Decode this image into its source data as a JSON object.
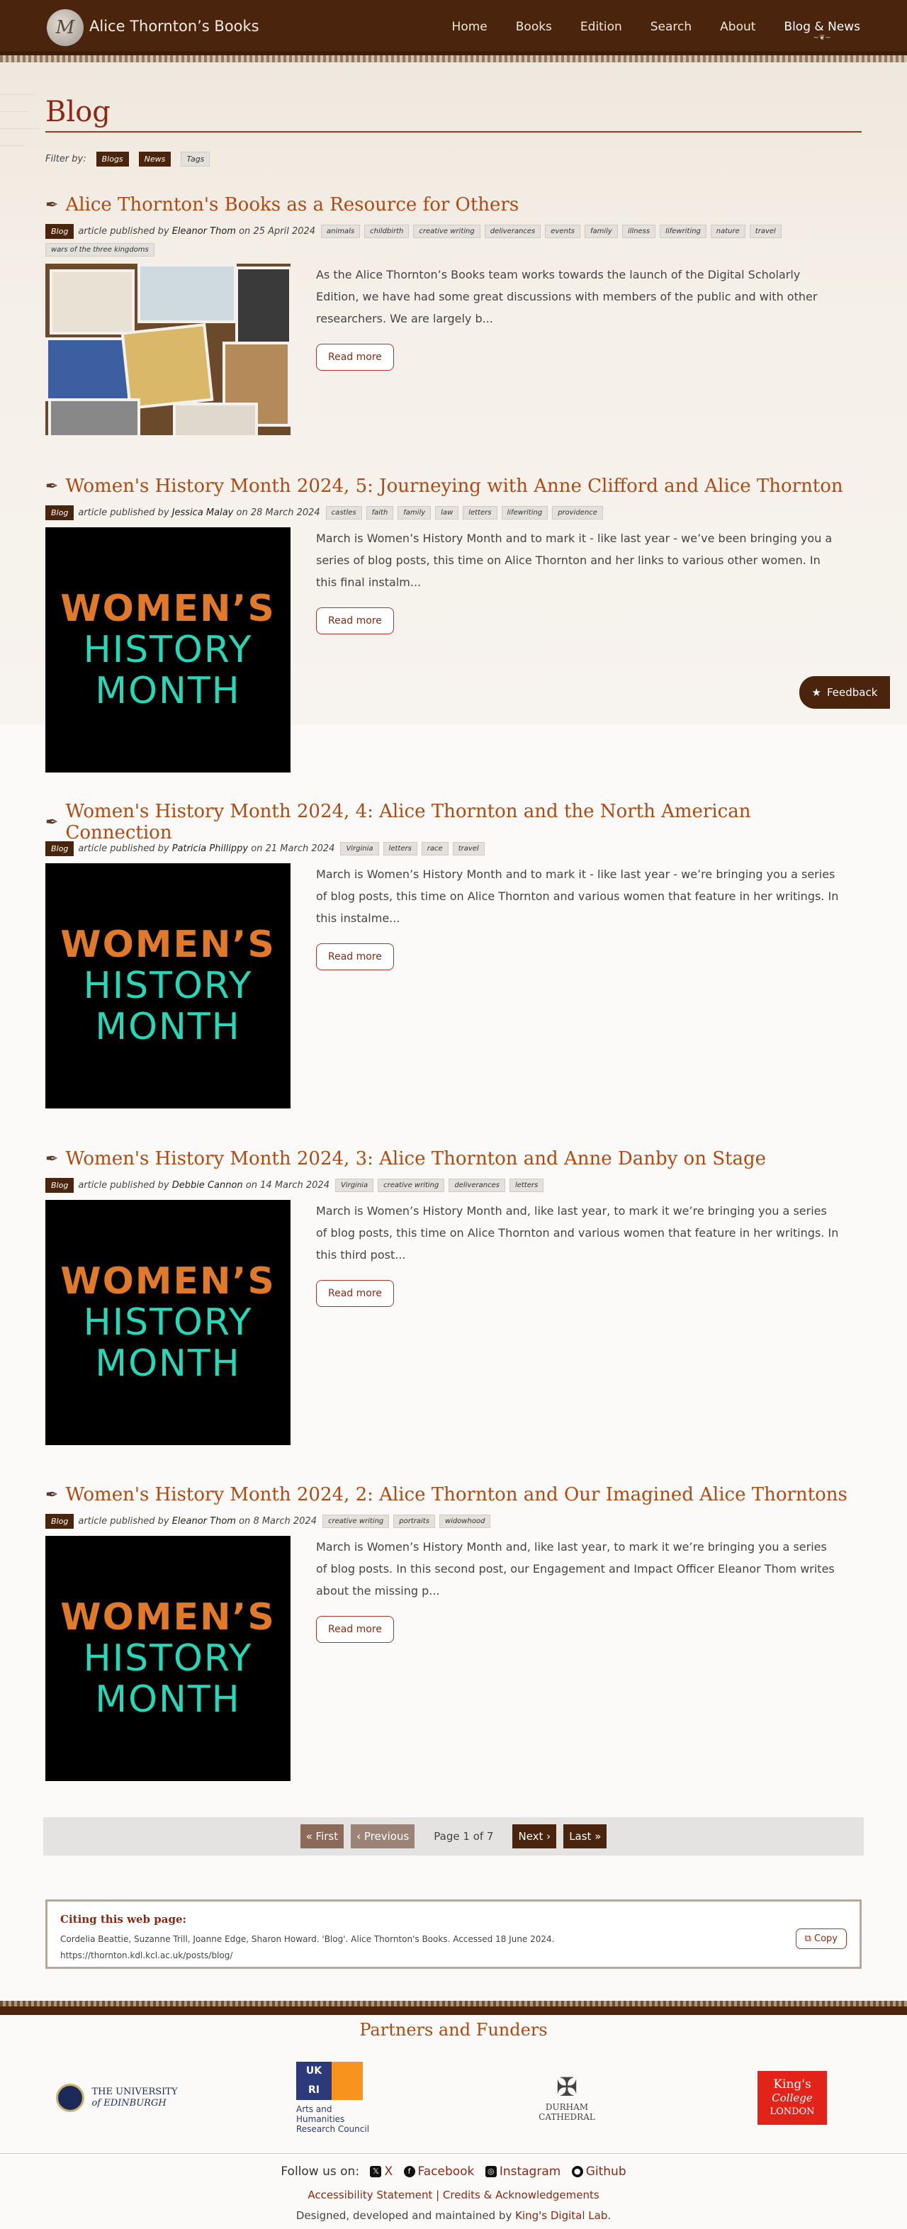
{
  "header": {
    "logo_glyph": "M",
    "site_title": "Alice Thornton’s Books",
    "nav": [
      "Home",
      "Books",
      "Edition",
      "Search",
      "About",
      "Blog & News"
    ]
  },
  "page": {
    "title": "Blog",
    "filter_label": "Filter by:",
    "filters": [
      "Blogs",
      "News",
      "Tags"
    ]
  },
  "posts": [
    {
      "title": "Alice Thornton's Books as a Resource for Others",
      "type": "Blog",
      "published_prefix": "article published by",
      "author": "Eleanor Thom",
      "date_prefix": "on",
      "date": "25 April 2024",
      "tags": [
        "animals",
        "childbirth",
        "creative writing",
        "deliverances",
        "events",
        "family",
        "illness",
        "lifewriting",
        "nature",
        "travel",
        "wars of the three kingdoms"
      ],
      "excerpt": "As the Alice Thornton’s Books team works towards the launch of the Digital Scholarly Edition, we have had some great discussions with members of the public and with other researchers. We are largely b...",
      "read_more": "Read more"
    },
    {
      "title": "Women's History Month 2024, 5: Journeying with Anne Clifford and Alice Thornton",
      "type": "Blog",
      "published_prefix": "article published by",
      "author": "Jessica Malay",
      "date_prefix": "on",
      "date": "28 March 2024",
      "tags": [
        "castles",
        "faith",
        "family",
        "law",
        "letters",
        "lifewriting",
        "providence"
      ],
      "excerpt": "March is Women’s History Month and to mark it - like last year - we’ve been bringing you a series of blog posts, this time on Alice Thornton and her links to various other women. In this final instalm...",
      "read_more": "Read more",
      "image_text": [
        "WOMEN’S",
        "HISTORY",
        "MONTH"
      ]
    },
    {
      "title": "Women's History Month 2024, 4: Alice Thornton and the North American Connection",
      "type": "Blog",
      "published_prefix": "article published by",
      "author": "Patricia Phillippy",
      "date_prefix": "on",
      "date": "21 March 2024",
      "tags": [
        "Virginia",
        "letters",
        "race",
        "travel"
      ],
      "excerpt": "March is Women’s History Month and to mark it - like last year - we’re bringing you a series of blog posts, this time on Alice Thornton and various women that feature in her writings. In this instalme...",
      "read_more": "Read more",
      "image_text": [
        "WOMEN’S",
        "HISTORY",
        "MONTH"
      ]
    },
    {
      "title": "Women's History Month 2024, 3: Alice Thornton and Anne Danby on Stage",
      "type": "Blog",
      "published_prefix": "article published by",
      "author": "Debbie Cannon",
      "date_prefix": "on",
      "date": "14 March 2024",
      "tags": [
        "Virginia",
        "creative writing",
        "deliverances",
        "letters"
      ],
      "excerpt": "March is Women’s History Month and, like last year, to mark it we’re bringing you a series of blog posts, this time on Alice Thornton and various women that feature in her writings. In this third post...",
      "read_more": "Read more",
      "image_text": [
        "WOMEN’S",
        "HISTORY",
        "MONTH"
      ]
    },
    {
      "title": "Women's History Month 2024, 2: Alice Thornton and Our Imagined Alice Thorntons",
      "type": "Blog",
      "published_prefix": "article published by",
      "author": "Eleanor Thom",
      "date_prefix": "on",
      "date": "8 March 2024",
      "tags": [
        "creative writing",
        "portraits",
        "widowhood"
      ],
      "excerpt": "March is Women’s History Month and, like last year, to mark it we’re bringing you a series of blog posts. In this second post, our Engagement and Impact Officer Eleanor Thom writes about the missing p...",
      "read_more": "Read more",
      "image_text": [
        "WOMEN’S",
        "HISTORY",
        "MONTH"
      ]
    }
  ],
  "feedback": "Feedback",
  "pagination": {
    "first": "« First",
    "previous": "‹ Previous",
    "status": "Page 1 of 7",
    "next": "Next ›",
    "last": "Last »"
  },
  "citation": {
    "title": "Citing this web page:",
    "text": "Cordelia Beattie, Suzanne Trill, Joanne Edge, Sharon Howard. 'Blog'. Alice Thornton's Books. Accessed 18 June 2024.",
    "url": "https://thornton.kdl.kcl.ac.uk/posts/blog/",
    "copy": "Copy"
  },
  "footer": {
    "partners_title": "Partners and Funders",
    "partners": {
      "edinburgh": [
        "THE UNIVERSITY",
        "of EDINBURGH"
      ],
      "ukri": [
        "Arts and",
        "Humanities",
        "Research Council"
      ],
      "durham": [
        "DURHAM",
        "CATHEDRAL"
      ],
      "kings": [
        "King's",
        "College",
        "LONDON"
      ]
    },
    "follow_label": "Follow us on:",
    "social": [
      "X",
      "Facebook",
      "Instagram",
      "Github"
    ],
    "links": "Accessibility Statement | Credits & Acknowledgements",
    "made_by": "Designed, developed and maintained by",
    "lab": "King's Digital Lab",
    "made_end": "."
  }
}
